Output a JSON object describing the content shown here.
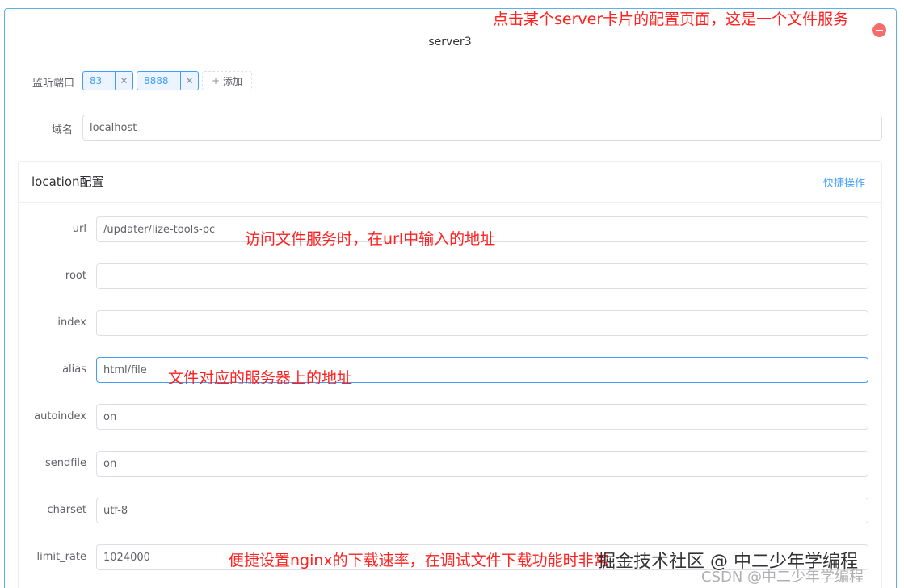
{
  "server": {
    "title": "server3",
    "ports_label": "监听端口",
    "ports": [
      "83",
      "8888"
    ],
    "add_port_label": "添加",
    "domain_label": "域名",
    "domain_value": "localhost"
  },
  "location": {
    "title": "location配置",
    "quick_ops_label": "快捷操作",
    "fields": [
      {
        "label": "url",
        "value": "/updater/lize-tools-pc"
      },
      {
        "label": "root",
        "value": ""
      },
      {
        "label": "index",
        "value": ""
      },
      {
        "label": "alias",
        "value": "html/file"
      },
      {
        "label": "autoindex",
        "value": "on"
      },
      {
        "label": "sendfile",
        "value": "on"
      },
      {
        "label": "charset",
        "value": "utf-8"
      },
      {
        "label": "limit_rate",
        "value": "1024000"
      }
    ]
  },
  "annotations": {
    "top": "点击某个server卡片的配置页面，这是一个文件服务",
    "url": "访问文件服务时，在url中输入的地址",
    "alias": "文件对应的服务器上的地址",
    "rate": "便捷设置nginx的下载速率，在调试文件下载功能时非常"
  },
  "watermark": {
    "main": "掘金技术社区 @ 中二少年学编程",
    "sub": "CSDN @中二少年学编程"
  },
  "colors": {
    "accent": "#409eff",
    "border_highlight": "#5ab3e4",
    "danger": "#f56c6c",
    "annotation": "#ff2020"
  }
}
